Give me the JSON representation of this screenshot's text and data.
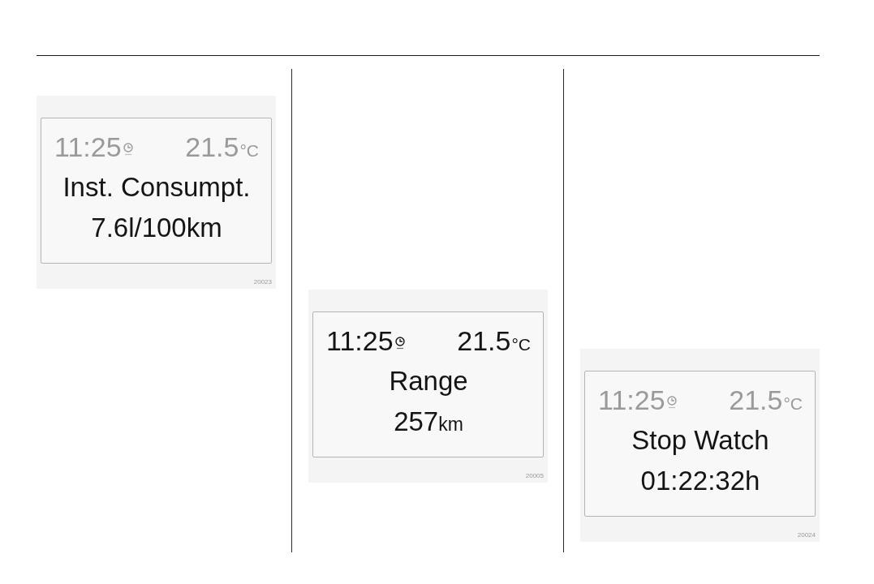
{
  "figures": [
    {
      "status_bar": {
        "time": "11:25",
        "temperature": "21.5",
        "temperature_unit": "°C",
        "dimmed": true
      },
      "title": "Inst. Consumpt.",
      "reading": "7.6l/100km",
      "figure_number": "20023"
    },
    {
      "status_bar": {
        "time": "11:25",
        "temperature": "21.5",
        "temperature_unit": "°C",
        "dimmed": false
      },
      "title": "Range",
      "reading": "257",
      "reading_unit": "km",
      "figure_number": "20005"
    },
    {
      "status_bar": {
        "time": "11:25",
        "temperature": "21.5",
        "temperature_unit": "°C",
        "dimmed": true
      },
      "title": "Stop Watch",
      "reading": "01:22:32h",
      "figure_number": "20024"
    }
  ]
}
